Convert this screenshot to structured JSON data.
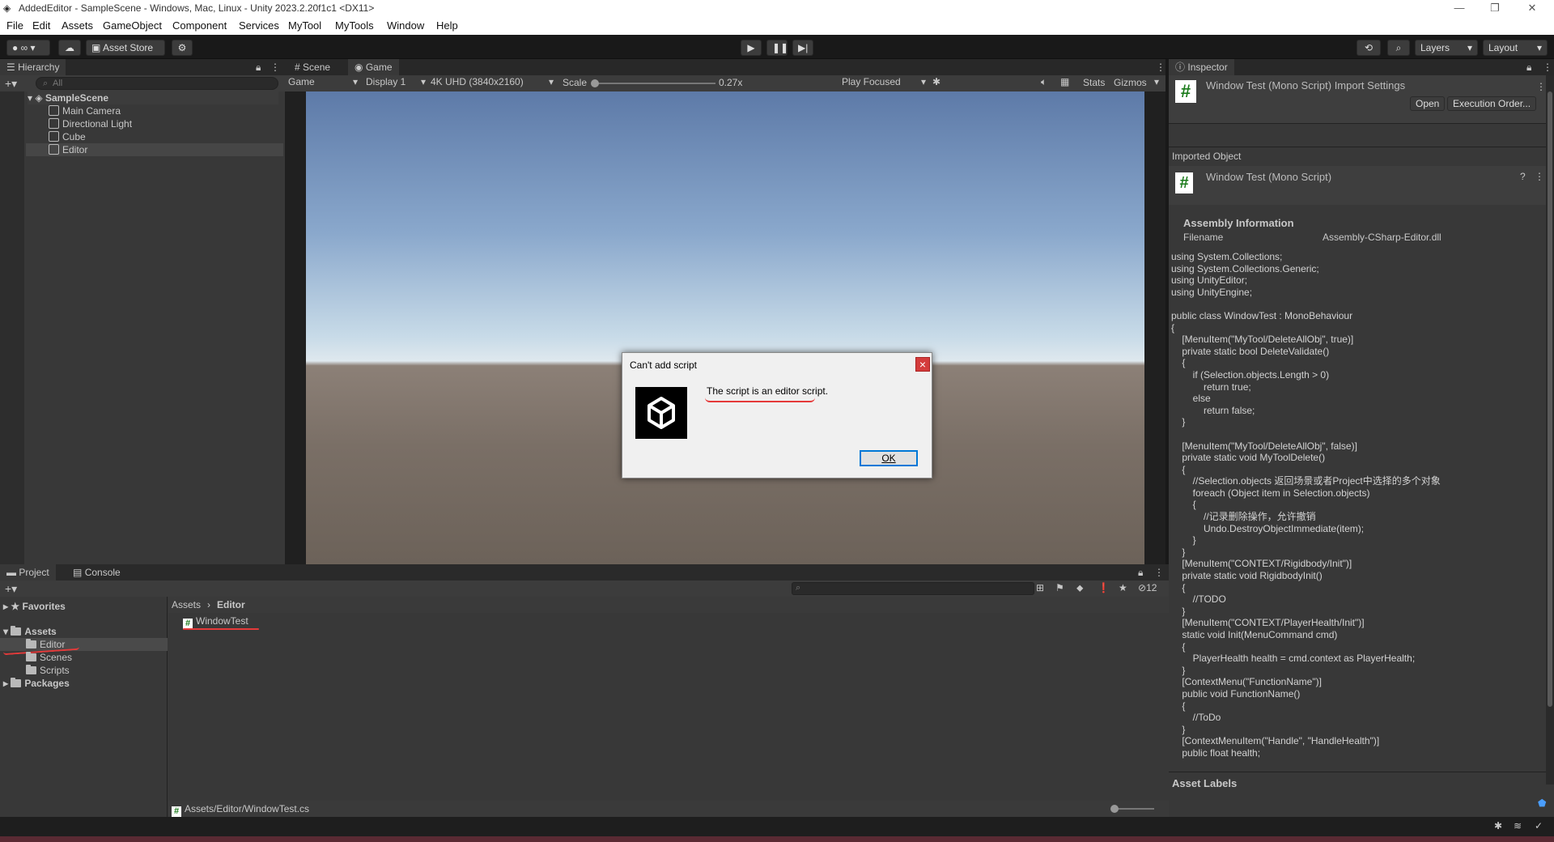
{
  "window": {
    "title": "AddedEditor - SampleScene - Windows, Mac, Linux - Unity 2023.2.20f1c1 <DX11>",
    "controls": [
      "—",
      "❐",
      "✕"
    ]
  },
  "menu": [
    "File",
    "Edit",
    "Assets",
    "GameObject",
    "Component",
    "Services",
    "MyTool",
    "MyTools",
    "Window",
    "Help"
  ],
  "toolbar": {
    "account_label": "∞",
    "asset_store": "Asset Store",
    "layers": "Layers",
    "layout": "Layout"
  },
  "hierarchy": {
    "tab": "Hierarchy",
    "search_placeholder": "All",
    "scene": "SampleScene",
    "items": [
      "Main Camera",
      "Directional Light",
      "Cube",
      "Editor"
    ]
  },
  "game_view": {
    "tabs": [
      "Scene",
      "Game"
    ],
    "mode": "Game",
    "display": "Display 1",
    "resolution": "4K UHD (3840x2160)",
    "scale_label": "Scale",
    "scale_value": "0.27x",
    "play_mode": "Play Focused",
    "stats": "Stats",
    "gizmos": "Gizmos"
  },
  "dialog": {
    "title": "Can't add script",
    "message": "The script is an editor script.",
    "ok": "OK",
    "close": "×"
  },
  "project": {
    "tabs": [
      "Project",
      "Console"
    ],
    "favorites": "Favorites",
    "assets": "Assets",
    "folders": [
      "Editor",
      "Scenes",
      "Scripts"
    ],
    "packages": "Packages",
    "breadcrumb": [
      "Assets",
      "Editor"
    ],
    "files": [
      "WindowTest"
    ],
    "status_path": "Assets/Editor/WindowTest.cs",
    "hidden_count": "12"
  },
  "inspector": {
    "tab": "Inspector",
    "header_title": "Window Test (Mono Script) Import Settings",
    "open": "Open",
    "execution_order": "Execution Order...",
    "imported_object": "Imported Object",
    "object_title": "Window Test (Mono Script)",
    "assembly_info": "Assembly Information",
    "filename_label": "Filename",
    "filename_value": "Assembly-CSharp-Editor.dll",
    "asset_labels": "Asset Labels",
    "code_lines": [
      "using System.Collections;",
      "using System.Collections.Generic;",
      "using UnityEditor;",
      "using UnityEngine;",
      "",
      "public class WindowTest : MonoBehaviour",
      "{",
      "    [MenuItem(\"MyTool/DeleteAllObj\", true)]",
      "    private static bool DeleteValidate()",
      "    {",
      "        if (Selection.objects.Length > 0)",
      "            return true;",
      "        else",
      "            return false;",
      "    }",
      "",
      "    [MenuItem(\"MyTool/DeleteAllObj\", false)]",
      "    private static void MyToolDelete()",
      "    {",
      "        //Selection.objects 返回场景或者Project中选择的多个对象",
      "        foreach (Object item in Selection.objects)",
      "        {",
      "            //记录删除操作，允许撤销",
      "            Undo.DestroyObjectImmediate(item);",
      "        }",
      "    }",
      "    [MenuItem(\"CONTEXT/Rigidbody/Init\")]",
      "    private static void RigidbodyInit()",
      "    {",
      "        //TODO",
      "    }",
      "    [MenuItem(\"CONTEXT/PlayerHealth/Init\")]",
      "    static void Init(MenuCommand cmd)",
      "    {",
      "        PlayerHealth health = cmd.context as PlayerHealth;",
      "    }",
      "    [ContextMenu(\"FunctionName\")]",
      "    public void FunctionName()",
      "    {",
      "        //ToDo",
      "    }",
      "    [ContextMenuItem(\"Handle\", \"HandleHealth\")]",
      "    public float health;"
    ]
  }
}
